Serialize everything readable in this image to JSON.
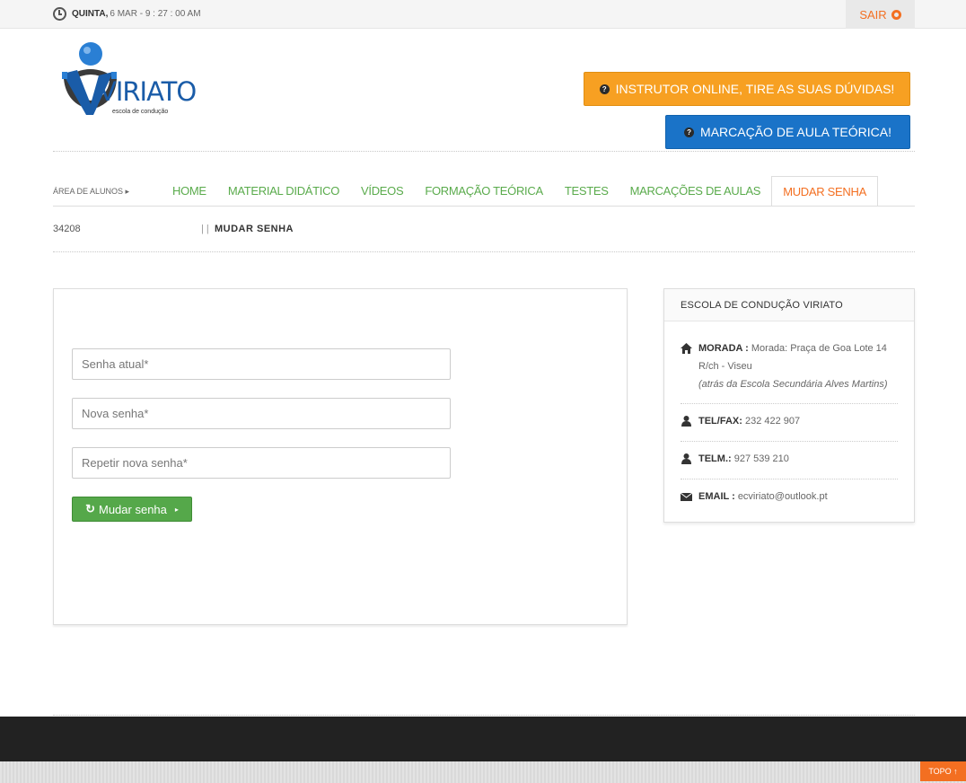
{
  "topbar": {
    "day": "QUINTA,",
    "datetime": "6 MAR - 9 : 27 : 00 AM",
    "logout_label": "SAIR"
  },
  "brand": {
    "name": "VIRIATO",
    "tagline": "escola de condução",
    "accent_blue": "#1a5ca8"
  },
  "header": {
    "instructor_label": "INSTRUTOR ONLINE, TIRE AS SUAS DÚVIDAS!",
    "marcacao_label": "MARCAÇÃO DE AULA TEÓRICA!"
  },
  "nav": {
    "area_label": "ÁREA DE ALUNOS ▸",
    "items": [
      {
        "label": "HOME"
      },
      {
        "label": "MATERIAL DIDÁTICO"
      },
      {
        "label": "VÍDEOS"
      },
      {
        "label": "FORMAÇÃO TEÓRICA"
      },
      {
        "label": "TESTES"
      },
      {
        "label": "MARCAÇÕES DE AULAS"
      },
      {
        "label": "MUDAR SENHA"
      }
    ],
    "active_index": 6,
    "colors": {
      "link": "#5aab4c",
      "active": "#f36f21"
    }
  },
  "breadcrumb": {
    "student_id": "34208",
    "separator": "| |",
    "current": "MUDAR SENHA"
  },
  "form": {
    "current_password_placeholder": "Senha atual*",
    "new_password_placeholder": "Nova senha*",
    "repeat_password_placeholder": "Repetir nova senha*",
    "submit_label": "Mudar senha"
  },
  "school": {
    "title": "ESCOLA DE CONDUÇÃO VIRIATO",
    "morada_label": "MORADA :",
    "morada_value": "Morada: Praça de Goa Lote 14 R/ch - Viseu",
    "morada_note": "(atrás da Escola Secundária Alves Martins)",
    "telfax_label": "TEL/FAX:",
    "telfax_value": "232 422 907",
    "telm_label": "TELM.:",
    "telm_value": "927 539 210",
    "email_label": "EMAIL :",
    "email_value": "ecviriato@outlook.pt"
  },
  "footer": {
    "topo_label": "TOPO ↑"
  }
}
